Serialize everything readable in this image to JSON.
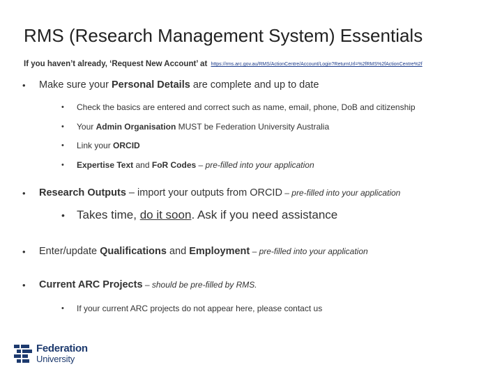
{
  "title": "RMS (Research Management System) Essentials",
  "intro": {
    "text": "If you haven’t already, ‘Request New Account’ at",
    "link": "https://rms.arc.gov.au/RMS/ActionCentre/Account/Login?ReturnUrl=%2fRMS%2fActionCentre%2f"
  },
  "b1": {
    "bullet": "•",
    "pre": "Make sure your ",
    "bold": "Personal Details",
    "post": " are complete and up to date",
    "items": [
      {
        "text": "Check the basics are entered and correct such as name, email, phone, DoB and citizenship"
      },
      {
        "pre": "Your ",
        "bold": "Admin Organisation",
        "post": " MUST be Federation University Australia"
      },
      {
        "pre": "Link your ",
        "bold": "ORCID"
      },
      {
        "bold1": "Expertise Text",
        "mid": " and ",
        "bold2": "FoR Codes",
        "dash": " – ",
        "italic": "pre-filled into your application"
      }
    ]
  },
  "b2": {
    "bold": "Research Outputs",
    "mid": " – import your outputs from ORCID",
    "dash": " – ",
    "italic": "pre-filled into your application",
    "sub": {
      "pre": "Takes time, ",
      "underline": "do it soon",
      "post": ".  Ask if you need assistance"
    }
  },
  "b3": {
    "pre": "Enter/update ",
    "bold1": "Qualifications",
    "mid": " and ",
    "bold2": "Employment",
    "dash": " – ",
    "italic": "pre-filled into your application"
  },
  "b4": {
    "bold": "Current ARC Projects",
    "dash": " – ",
    "italic": "should be pre-filled by RMS.",
    "sub": "If your current ARC projects do not appear here, please contact us"
  },
  "logo": {
    "line1": "Federation",
    "line2": "University"
  },
  "colors": {
    "logo": "#1d3a6e",
    "text": "#333333",
    "link": "#1a3a8a"
  }
}
